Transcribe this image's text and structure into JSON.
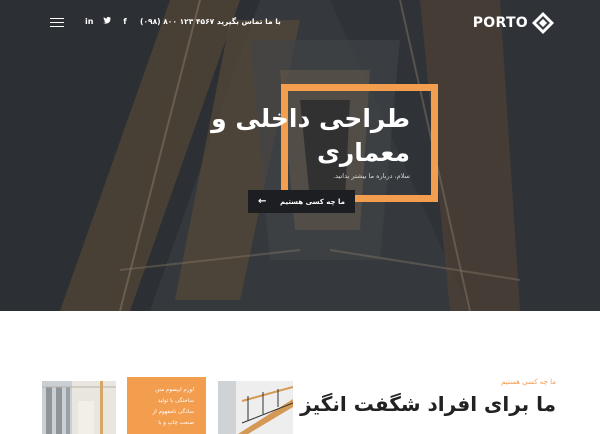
{
  "header": {
    "logo_text": "PORTO",
    "contact": "با ما تماس بگیرید ۴۵۶۷ ۱۲۳ ۸۰۰ (۰۹۸)",
    "social": [
      {
        "icon": "facebook-icon",
        "glyph": "f"
      },
      {
        "icon": "twitter-icon",
        "glyph": "t"
      },
      {
        "icon": "linkedin-icon",
        "glyph": "in"
      }
    ]
  },
  "hero": {
    "title_line1": "طراحی داخلی و",
    "title_line2": "معماری",
    "subtitle": "سلام، درباره ما بیشتر بدانید.",
    "button_label": "ما چه کسی هستیم"
  },
  "about": {
    "tag": "ما چه کسی هستیم",
    "title": "ما برای افراد شگفت انگیز",
    "card_lines": [
      "لورم ایپسوم متن",
      "ساختگی با تولید",
      "سادگی نامفهوم از",
      "صنعت چاپ و با"
    ]
  },
  "colors": {
    "accent": "#f39d4e",
    "dark": "#1c1e22"
  }
}
